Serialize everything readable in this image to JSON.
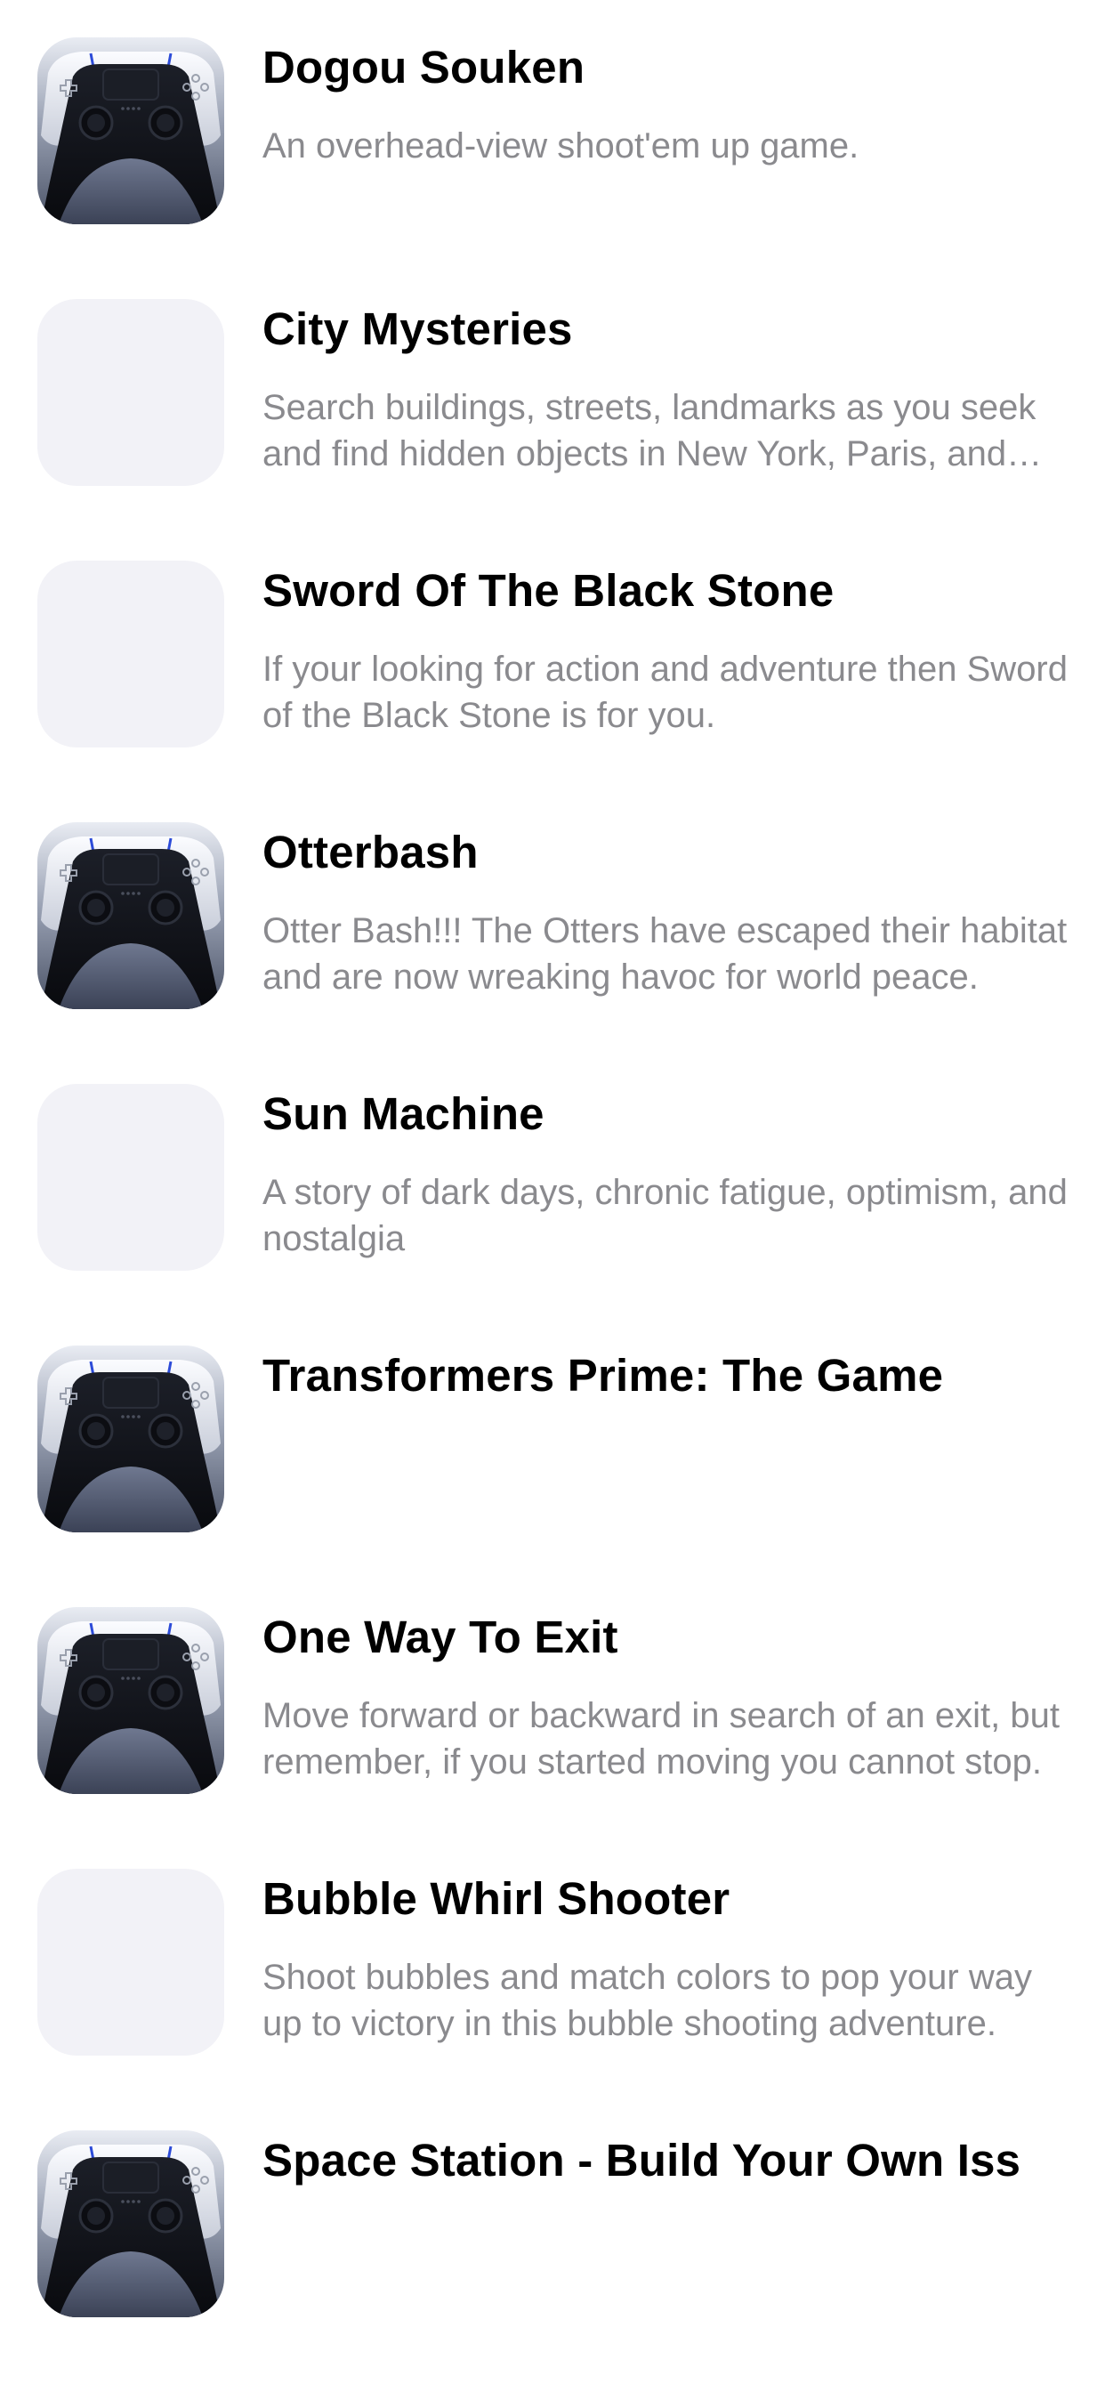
{
  "colors": {
    "title": "#000000",
    "description": "#8a8a8e",
    "placeholder_icon": "#f2f2f7",
    "accent_blue": "#2c4bd8"
  },
  "games": [
    {
      "title": "Dogou Souken",
      "description": "An overhead-view shoot'em up game.",
      "icon": "gamepad-icon"
    },
    {
      "title": "City Mysteries",
      "description": "Search buildings, streets, landmarks as you seek and find hidden objects in New York, Paris, and other cities.",
      "icon": "placeholder-icon"
    },
    {
      "title": "Sword Of The Black Stone",
      "description": "If your looking for action and adventure then Sword of the Black Stone is for you.",
      "icon": "placeholder-icon"
    },
    {
      "title": "Otterbash",
      "description": "Otter Bash!!! The Otters have escaped their habitat and are now wreaking havoc for world peace.",
      "icon": "gamepad-icon"
    },
    {
      "title": "Sun Machine",
      "description": "A story of dark days, chronic fatigue, optimism, and nostalgia",
      "icon": "placeholder-icon"
    },
    {
      "title": "Transformers Prime: The Game",
      "description": "",
      "icon": "gamepad-icon"
    },
    {
      "title": "One Way To Exit",
      "description": "Move forward or backward in search of an exit, but remember, if you started moving you cannot stop.",
      "icon": "gamepad-icon"
    },
    {
      "title": "Bubble Whirl Shooter",
      "description": "Shoot bubbles and match colors to pop your way up to victory in this bubble shooting adventure.",
      "icon": "placeholder-icon"
    },
    {
      "title": "Space Station - Build Your Own Iss",
      "description": "",
      "icon": "gamepad-icon"
    }
  ]
}
